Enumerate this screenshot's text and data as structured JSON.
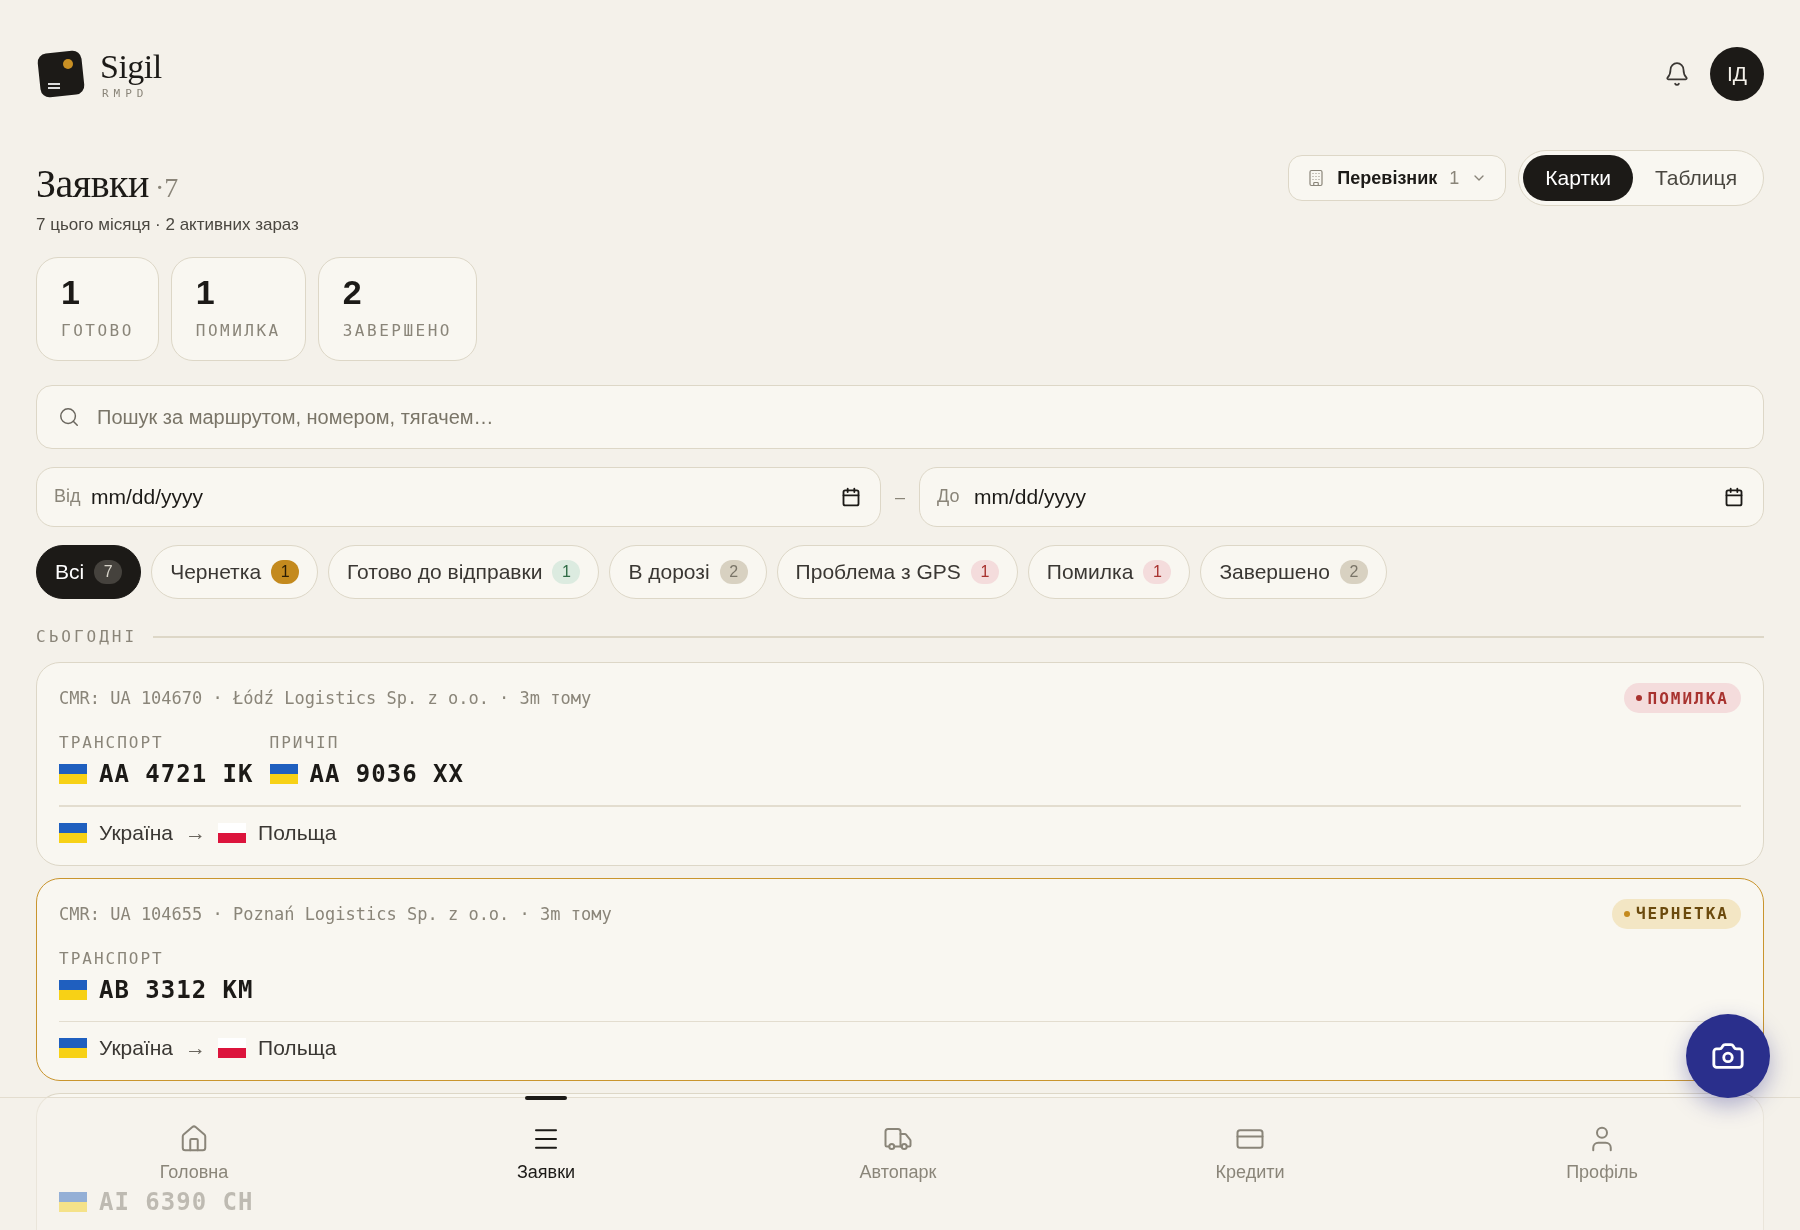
{
  "brand": {
    "name": "Sigil",
    "tagline": "RMPD"
  },
  "header": {
    "avatar": "ІД"
  },
  "page": {
    "title": "Заявки",
    "count": "·7",
    "subtitle": "7 цього місяця · 2 активних зараз"
  },
  "carrier_filter": {
    "label": "Перевізник",
    "count": "1"
  },
  "view_toggle": [
    {
      "label": "Картки",
      "selected": true
    },
    {
      "label": "Таблиця",
      "selected": false
    }
  ],
  "stats": [
    {
      "value": "1",
      "label": "ГОТОВО"
    },
    {
      "value": "1",
      "label": "ПОМИЛКА"
    },
    {
      "value": "2",
      "label": "ЗАВЕРШЕНО"
    }
  ],
  "search": {
    "placeholder": "Пошук за маршрутом, номером, тягачем…"
  },
  "date_range": {
    "from": {
      "label": "Від",
      "placeholder": "mm/dd/yyyy"
    },
    "separator": "–",
    "to": {
      "label": "До",
      "placeholder": "mm/dd/yyyy"
    }
  },
  "filters": [
    {
      "label": "Всі",
      "count": "7",
      "kind": "all",
      "selected": true
    },
    {
      "label": "Чернетка",
      "count": "1",
      "kind": "draft",
      "selected": false
    },
    {
      "label": "Готово до відправки",
      "count": "1",
      "kind": "ready",
      "selected": false
    },
    {
      "label": "В дорозі",
      "count": "2",
      "kind": "neutral",
      "selected": false
    },
    {
      "label": "Проблема з GPS",
      "count": "1",
      "kind": "error",
      "selected": false
    },
    {
      "label": "Помилка",
      "count": "1",
      "kind": "error",
      "selected": false
    },
    {
      "label": "Завершено",
      "count": "2",
      "kind": "neutral",
      "selected": false
    }
  ],
  "section": "СЬОГОДНІ",
  "cards": [
    {
      "meta": "CMR: UA 104670 · Łódź Logistics Sp. z o.o. · 3m тому",
      "status": {
        "label": "ПОМИЛКА",
        "kind": "error"
      },
      "highlighted": false,
      "vehicles": [
        {
          "label": "ТРАНСПОРТ",
          "plate": "AA 4721 IK"
        },
        {
          "label": "ПРИЧІП",
          "plate": "AA 9036 XX"
        }
      ],
      "route": {
        "from": "Україна",
        "arrow": "→",
        "to": "Польща"
      }
    },
    {
      "meta": "CMR: UA 104655 · Poznań Logistics Sp. z o.o. · 3m тому",
      "status": {
        "label": "ЧЕРНЕТКА",
        "kind": "draft"
      },
      "highlighted": true,
      "vehicles": [
        {
          "label": "ТРАНСПОРТ",
          "plate": "AB 3312 KM"
        }
      ],
      "route": {
        "from": "Україна",
        "arrow": "→",
        "to": "Польща"
      }
    }
  ],
  "partial_card": {
    "plate": "AI 6390 CH"
  },
  "nav": [
    {
      "label": "Головна",
      "selected": false
    },
    {
      "label": "Заявки",
      "selected": true
    },
    {
      "label": "Автопарк",
      "selected": false
    },
    {
      "label": "Кредити",
      "selected": false
    },
    {
      "label": "Профіль",
      "selected": false
    }
  ]
}
